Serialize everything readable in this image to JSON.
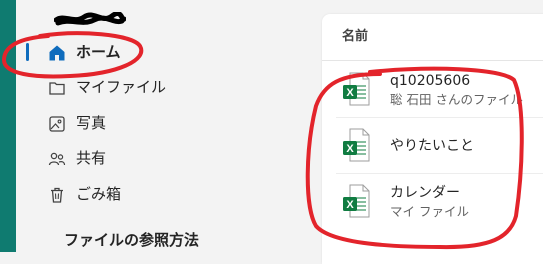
{
  "sidebar": {
    "items": [
      {
        "name": "home",
        "icon": "home-icon",
        "label": "ホーム",
        "active": true
      },
      {
        "name": "my-files",
        "icon": "folder-icon",
        "label": "マイファイル"
      },
      {
        "name": "photos",
        "icon": "photo-icon",
        "label": "写真"
      },
      {
        "name": "shared",
        "icon": "people-icon",
        "label": "共有"
      },
      {
        "name": "recycle-bin",
        "icon": "trash-icon",
        "label": "ごみ箱"
      }
    ],
    "section_title": "ファイルの参照方法"
  },
  "main": {
    "column_header": "名前",
    "files": [
      {
        "name": "q10205606",
        "sub": "聡 石田 さんのファイル",
        "icon": "excel-icon"
      },
      {
        "name": "やりたいこと",
        "sub": "",
        "icon": "excel-icon"
      },
      {
        "name": "カレンダー",
        "sub": "マイ ファイル",
        "icon": "excel-icon"
      }
    ]
  },
  "colors": {
    "accent": "#0f6cbd",
    "strip": "#0f7b70",
    "excel": "#107c41",
    "annotation": "#e3242b"
  }
}
